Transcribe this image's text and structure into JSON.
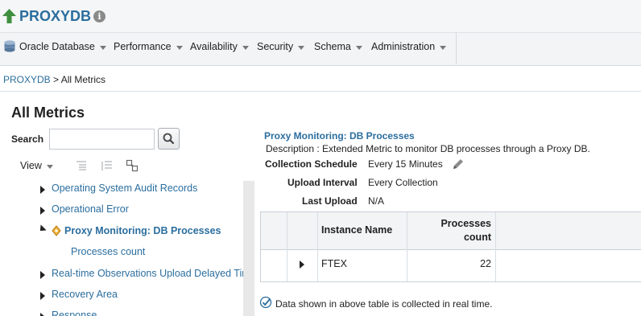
{
  "header": {
    "target_name": "PROXYDB",
    "info_glyph": "i"
  },
  "menubar": {
    "items": [
      {
        "label": "Oracle Database",
        "icon": "database-icon"
      },
      {
        "label": "Performance"
      },
      {
        "label": "Availability"
      },
      {
        "label": "Security"
      },
      {
        "label": "Schema"
      },
      {
        "label": "Administration"
      }
    ]
  },
  "breadcrumb": {
    "link": "PROXYDB",
    "separator": ">",
    "current": "All Metrics"
  },
  "page": {
    "title": "All Metrics"
  },
  "left_panel": {
    "search_label": "Search",
    "search_value": "",
    "view_label": "View",
    "toolbar_icons": [
      "expand-all-icon",
      "collapse-all-icon",
      "detach-icon"
    ],
    "tree": [
      {
        "label": "Operating System Audit Records",
        "state": "collapsed"
      },
      {
        "label": "Operational Error",
        "state": "collapsed"
      },
      {
        "label": "Proxy Monitoring: DB Processes",
        "state": "expanded",
        "selected": true
      },
      {
        "label": "Processes count",
        "state": "leaf"
      },
      {
        "label": "Real-time Observations Upload Delayed Time",
        "state": "collapsed"
      },
      {
        "label": "Recovery Area",
        "state": "collapsed"
      },
      {
        "label": "Response",
        "state": "collapsed"
      }
    ]
  },
  "detail": {
    "title": "Proxy Monitoring: DB Processes",
    "description": "Description : Extended Metric to monitor DB processes through a Proxy DB.",
    "collection_schedule_label": "Collection Schedule",
    "collection_schedule_value": "Every 15 Minutes",
    "upload_interval_label": "Upload Interval",
    "upload_interval_value": "Every Collection",
    "last_upload_label": "Last Upload",
    "last_upload_value": "N/A",
    "table": {
      "columns": [
        "Instance Name",
        "Processes count"
      ],
      "rows": [
        {
          "instance_name": "FTEX",
          "processes_count": "22"
        }
      ]
    },
    "note": "Data shown in above table is collected in real time."
  },
  "colors": {
    "link": "#2b6e9e",
    "target_arrow": "#3f8f3f",
    "header_bg": "#f5f6f7"
  }
}
